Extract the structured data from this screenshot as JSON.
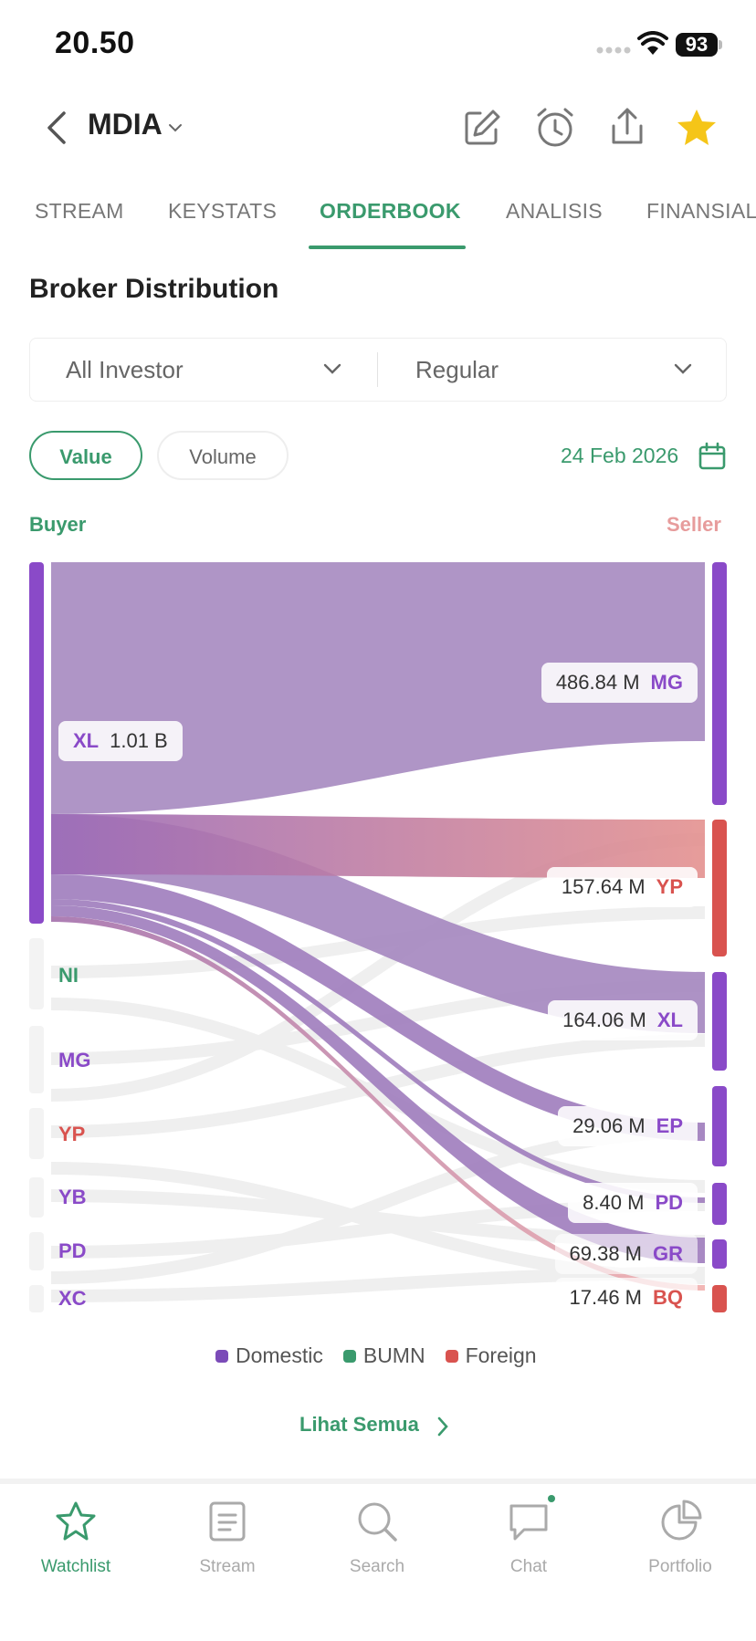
{
  "status": {
    "time": "20.50",
    "battery": "93"
  },
  "header": {
    "ticker": "MDIA"
  },
  "tabs": [
    "STREAM",
    "KEYSTATS",
    "ORDERBOOK",
    "ANALISIS",
    "FINANSIAL"
  ],
  "active_tab": "ORDERBOOK",
  "section_title": "Broker Distribution",
  "filters": {
    "investor": "All Investor",
    "market": "Regular"
  },
  "toggle": {
    "value_label": "Value",
    "volume_label": "Volume",
    "selected": "Value"
  },
  "date": "24 Feb 2026",
  "columns": {
    "buyer": "Buyer",
    "seller": "Seller"
  },
  "chart_data": {
    "type": "sankey",
    "buyers": [
      {
        "code": "XL",
        "value": "1.01 B",
        "category": "Domestic"
      },
      {
        "code": "NI",
        "category": "BUMN"
      },
      {
        "code": "MG",
        "category": "Domestic"
      },
      {
        "code": "YP",
        "category": "Foreign"
      },
      {
        "code": "YB",
        "category": "Domestic"
      },
      {
        "code": "PD",
        "category": "Domestic"
      },
      {
        "code": "XC",
        "category": "Domestic"
      }
    ],
    "sellers": [
      {
        "code": "MG",
        "value": "486.84 M",
        "category": "Domestic"
      },
      {
        "code": "YP",
        "value": "157.64 M",
        "category": "Foreign"
      },
      {
        "code": "XL",
        "value": "164.06 M",
        "category": "Domestic"
      },
      {
        "code": "EP",
        "value": "29.06 M",
        "category": "Domestic"
      },
      {
        "code": "PD",
        "value": "8.40 M",
        "category": "Domestic"
      },
      {
        "code": "GR",
        "value": "69.38 M",
        "category": "Domestic"
      },
      {
        "code": "BQ",
        "value": "17.46 M",
        "category": "Foreign"
      }
    ],
    "legend": [
      "Domestic",
      "BUMN",
      "Foreign"
    ]
  },
  "colors": {
    "accent": "#3a9a6d",
    "domestic": "#8a4ac8",
    "bumn": "#3a9a6d",
    "foreign": "#d9534f",
    "seller_header": "#e79c9c"
  },
  "see_all": "Lihat Semua",
  "nav": [
    "Watchlist",
    "Stream",
    "Search",
    "Chat",
    "Portfolio"
  ],
  "nav_active": "Watchlist"
}
